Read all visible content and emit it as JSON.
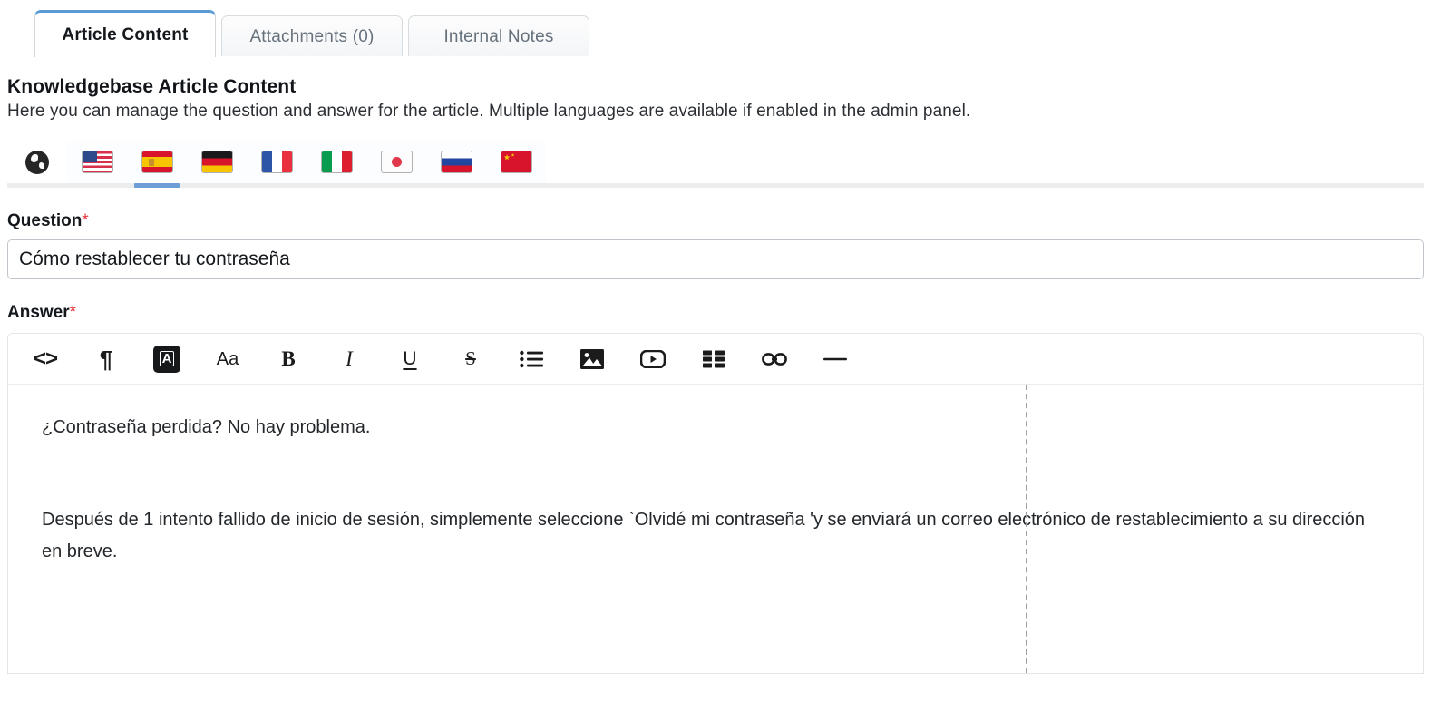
{
  "tabs": [
    {
      "label": "Article Content",
      "active": true
    },
    {
      "label": "Attachments (0)",
      "active": false
    },
    {
      "label": "Internal Notes",
      "active": false
    }
  ],
  "section": {
    "title": "Knowledgebase Article Content",
    "description": "Here you can manage the question and answer for the article. Multiple languages are available if enabled in the admin panel."
  },
  "languages": [
    {
      "name": "global",
      "icon": "globe-icon",
      "active": false
    },
    {
      "name": "english",
      "icon": "flag-us-icon",
      "active": false
    },
    {
      "name": "spanish",
      "icon": "flag-es-icon",
      "active": true
    },
    {
      "name": "german",
      "icon": "flag-de-icon",
      "active": false
    },
    {
      "name": "french",
      "icon": "flag-fr-icon",
      "active": false
    },
    {
      "name": "italian",
      "icon": "flag-it-icon",
      "active": false
    },
    {
      "name": "japanese",
      "icon": "flag-jp-icon",
      "active": false
    },
    {
      "name": "russian",
      "icon": "flag-ru-icon",
      "active": false
    },
    {
      "name": "chinese",
      "icon": "flag-cn-icon",
      "active": false
    }
  ],
  "question": {
    "label": "Question",
    "required_marker": "*",
    "value": "Cómo restablecer tu contraseña",
    "placeholder": ""
  },
  "answer": {
    "label": "Answer",
    "required_marker": "*",
    "toolbar": [
      {
        "name": "source-code-icon",
        "label": "<>"
      },
      {
        "name": "paragraph-icon",
        "label": "¶"
      },
      {
        "name": "font-color-icon",
        "label": "A"
      },
      {
        "name": "font-size-icon",
        "label": "Aa"
      },
      {
        "name": "bold-icon",
        "label": "B"
      },
      {
        "name": "italic-icon",
        "label": "I"
      },
      {
        "name": "underline-icon",
        "label": "U"
      },
      {
        "name": "strikethrough-icon",
        "label": "S"
      },
      {
        "name": "bullet-list-icon",
        "label": ""
      },
      {
        "name": "image-icon",
        "label": ""
      },
      {
        "name": "video-icon",
        "label": ""
      },
      {
        "name": "table-icon",
        "label": ""
      },
      {
        "name": "link-icon",
        "label": ""
      },
      {
        "name": "horizontal-rule-icon",
        "label": ""
      }
    ],
    "paragraphs": [
      "¿Contraseña perdida? No hay problema.",
      "Después de 1 intento fallido de inicio de sesión, simplemente seleccione `Olvidé mi contraseña 'y se enviará un correo electrónico de restablecimiento a su dirección en breve."
    ]
  },
  "colors": {
    "accent": "#5b9bd5",
    "lang_active_underline": "#6a9ed4",
    "required": "#e8353c",
    "text": "#14181c",
    "muted": "#66717c",
    "border": "#d7dce1"
  }
}
